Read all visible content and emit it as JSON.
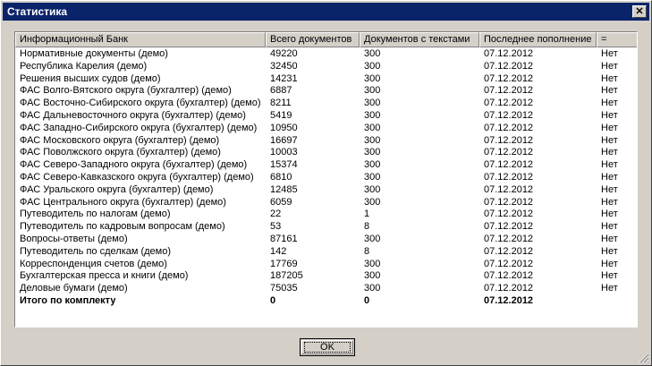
{
  "window": {
    "title": "Статистика",
    "close_glyph": "✕"
  },
  "table": {
    "columns": [
      "Информационный Банк",
      "Всего документов",
      "Документов с текстами",
      "Последнее пополнение",
      "="
    ],
    "rows": [
      [
        "Нормативные документы (демо)",
        "49220",
        "300",
        "07.12.2012",
        "Нет"
      ],
      [
        "Республика Карелия (демо)",
        "32450",
        "300",
        "07.12.2012",
        "Нет"
      ],
      [
        "Решения высших судов (демо)",
        "14231",
        "300",
        "07.12.2012",
        "Нет"
      ],
      [
        "ФАС Волго-Вятского округа (бухгалтер) (демо)",
        "6887",
        "300",
        "07.12.2012",
        "Нет"
      ],
      [
        "ФАС Восточно-Сибирского округа (бухгалтер) (демо)",
        "8211",
        "300",
        "07.12.2012",
        "Нет"
      ],
      [
        "ФАС Дальневосточного округа (бухгалтер) (демо)",
        "5419",
        "300",
        "07.12.2012",
        "Нет"
      ],
      [
        "ФАС Западно-Сибирского округа (бухгалтер) (демо)",
        "10950",
        "300",
        "07.12.2012",
        "Нет"
      ],
      [
        "ФАС Московского округа (бухгалтер) (демо)",
        "16697",
        "300",
        "07.12.2012",
        "Нет"
      ],
      [
        "ФАС Поволжского округа (бухгалтер) (демо)",
        "10003",
        "300",
        "07.12.2012",
        "Нет"
      ],
      [
        "ФАС Северо-Западного округа (бухгалтер) (демо)",
        "15374",
        "300",
        "07.12.2012",
        "Нет"
      ],
      [
        "ФАС Северо-Кавказского округа (бухгалтер) (демо)",
        "6810",
        "300",
        "07.12.2012",
        "Нет"
      ],
      [
        "ФАС Уральского округа (бухгалтер) (демо)",
        "12485",
        "300",
        "07.12.2012",
        "Нет"
      ],
      [
        "ФАС Центрального округа (бухгалтер) (демо)",
        "6059",
        "300",
        "07.12.2012",
        "Нет"
      ],
      [
        "Путеводитель по налогам (демо)",
        "22",
        "1",
        "07.12.2012",
        "Нет"
      ],
      [
        "Путеводитель по кадровым вопросам (демо)",
        "53",
        "8",
        "07.12.2012",
        "Нет"
      ],
      [
        "Вопросы-ответы (демо)",
        "87161",
        "300",
        "07.12.2012",
        "Нет"
      ],
      [
        "Путеводитель по сделкам (демо)",
        "142",
        "8",
        "07.12.2012",
        "Нет"
      ],
      [
        "Корреспонденция счетов (демо)",
        "17769",
        "300",
        "07.12.2012",
        "Нет"
      ],
      [
        "Бухгалтерская пресса и книги (демо)",
        "187205",
        "300",
        "07.12.2012",
        "Нет"
      ],
      [
        "Деловые бумаги (демо)",
        "75035",
        "300",
        "07.12.2012",
        "Нет"
      ]
    ],
    "total": [
      "Итого по комплекту",
      "0",
      "0",
      "07.12.2012",
      ""
    ]
  },
  "buttons": {
    "ok": "OK"
  }
}
